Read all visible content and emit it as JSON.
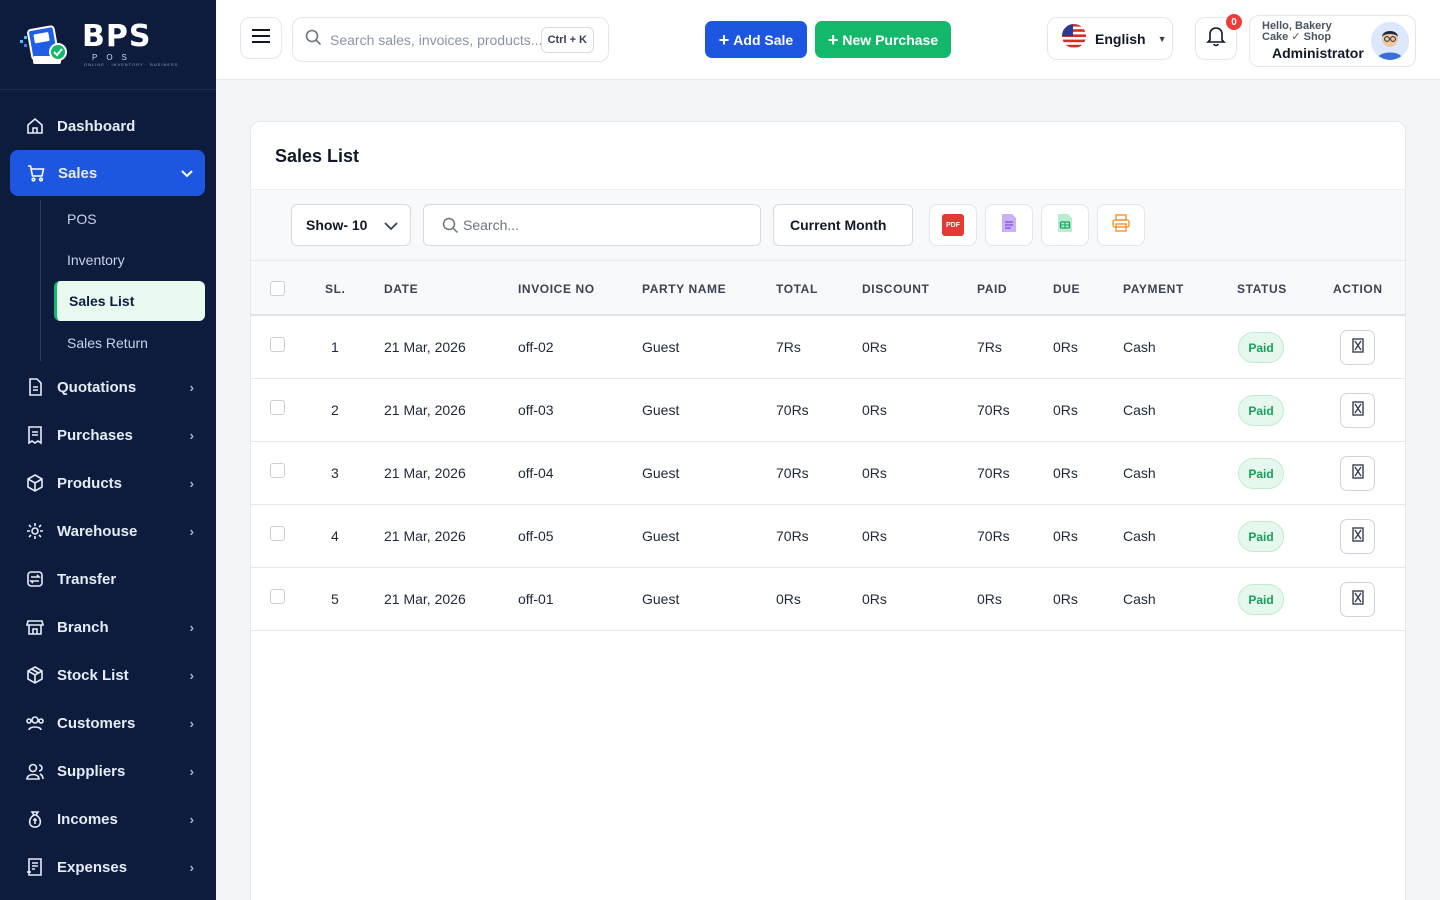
{
  "brand": {
    "name": "BPS",
    "sub": "POS",
    "tagline": "ONLINE · INVENTORY · BUSINESS"
  },
  "sidebar": {
    "items": [
      {
        "label": "Dashboard",
        "icon": "home-icon",
        "chevron": false
      },
      {
        "label": "Sales",
        "icon": "cart-icon",
        "chevron": true,
        "active": true
      },
      {
        "label": "Quotations",
        "icon": "document-icon",
        "chevron": true
      },
      {
        "label": "Purchases",
        "icon": "receipt-icon",
        "chevron": true
      },
      {
        "label": "Products",
        "icon": "box-icon",
        "chevron": true
      },
      {
        "label": "Warehouse",
        "icon": "warehouse-icon",
        "chevron": true
      },
      {
        "label": "Transfer",
        "icon": "transfer-icon",
        "chevron": false
      },
      {
        "label": "Branch",
        "icon": "store-icon",
        "chevron": true
      },
      {
        "label": "Stock List",
        "icon": "package-icon",
        "chevron": true
      },
      {
        "label": "Customers",
        "icon": "users-icon",
        "chevron": true
      },
      {
        "label": "Suppliers",
        "icon": "suppliers-icon",
        "chevron": true
      },
      {
        "label": "Incomes",
        "icon": "money-bag-icon",
        "chevron": true
      },
      {
        "label": "Expenses",
        "icon": "expense-icon",
        "chevron": true
      }
    ],
    "sales_sub": [
      "POS",
      "Inventory",
      "Sales List",
      "Sales Return"
    ]
  },
  "topbar": {
    "search_placeholder": "Search sales, invoices, products...",
    "shortcut": "Ctrl + K",
    "add_sale": "Add Sale",
    "new_purchase": "New Purchase",
    "language": "English",
    "notifications": "0",
    "greeting": "Hello, Bakery Cake ✓ Shop",
    "role": "Administrator"
  },
  "page": {
    "title": "Sales List",
    "show": "Show- 10",
    "search_placeholder": "Search...",
    "period": "Current Month",
    "export_pdf": "PDF"
  },
  "table": {
    "headers": [
      "SL.",
      "DATE",
      "INVOICE NO",
      "PARTY NAME",
      "TOTAL",
      "DISCOUNT",
      "PAID",
      "DUE",
      "PAYMENT",
      "STATUS",
      "ACTION"
    ],
    "rows": [
      [
        "1",
        "21 Mar, 2026",
        "off-02",
        "Guest",
        "7Rs",
        "0Rs",
        "7Rs",
        "0Rs",
        "Cash",
        "Paid"
      ],
      [
        "2",
        "21 Mar, 2026",
        "off-03",
        "Guest",
        "70Rs",
        "0Rs",
        "70Rs",
        "0Rs",
        "Cash",
        "Paid"
      ],
      [
        "3",
        "21 Mar, 2026",
        "off-04",
        "Guest",
        "70Rs",
        "0Rs",
        "70Rs",
        "0Rs",
        "Cash",
        "Paid"
      ],
      [
        "4",
        "21 Mar, 2026",
        "off-05",
        "Guest",
        "70Rs",
        "0Rs",
        "70Rs",
        "0Rs",
        "Cash",
        "Paid"
      ],
      [
        "5",
        "21 Mar, 2026",
        "off-01",
        "Guest",
        "0Rs",
        "0Rs",
        "0Rs",
        "0Rs",
        "Cash",
        "Paid"
      ]
    ]
  },
  "colors": {
    "sidebar": "#0d1b3d",
    "primary": "#1d56e0",
    "success": "#14b86a"
  }
}
